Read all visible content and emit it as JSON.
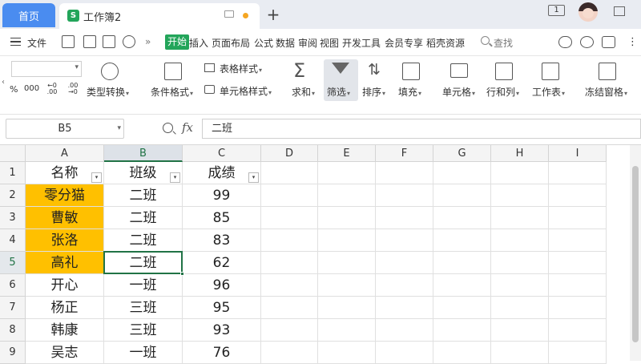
{
  "tabs": {
    "home": "首页",
    "doc_icon": "S",
    "doc_title": "工作簿2",
    "new_tab": "+"
  },
  "window": {
    "badge": "1"
  },
  "menu": {
    "file": "文件",
    "more": "»",
    "start": "开始",
    "insert": "插入",
    "page_layout": "页面布局",
    "formula": "公式",
    "data": "数据",
    "review": "审阅",
    "view": "视图",
    "developer": "开发工具",
    "member": "会员专享",
    "resources": "稻壳资源",
    "search": "查找"
  },
  "ribbon": {
    "percent": "%",
    "thousands": "000",
    "dec_inc": "←0 .00",
    "dec_dec": ".00 →0",
    "type_convert": "类型转换",
    "cond_format": "条件格式",
    "table_style": "表格样式",
    "cell_style": "单元格样式",
    "sum": "求和",
    "filter": "筛选",
    "sort": "排序",
    "fill": "填充",
    "cell": "单元格",
    "rowcol": "行和列",
    "sheet": "工作表",
    "freeze": "冻结窗格"
  },
  "formula_bar": {
    "name_box": "B5",
    "fx": "fx",
    "content": "二班"
  },
  "columns": [
    "A",
    "B",
    "C",
    "D",
    "E",
    "F",
    "G",
    "H",
    "I"
  ],
  "selected_column": "B",
  "selected_row": "5",
  "rows": [
    {
      "num": "1",
      "a": "名称",
      "b": "班级",
      "c": "成绩",
      "header": true
    },
    {
      "num": "2",
      "a": "零分猫",
      "b": "二班",
      "c": "99",
      "hl": true
    },
    {
      "num": "3",
      "a": "曹敏",
      "b": "二班",
      "c": "85",
      "hl": true
    },
    {
      "num": "4",
      "a": "张洛",
      "b": "二班",
      "c": "83",
      "hl": true
    },
    {
      "num": "5",
      "a": "高礼",
      "b": "二班",
      "c": "62",
      "hl": true
    },
    {
      "num": "6",
      "a": "开心",
      "b": "一班",
      "c": "96"
    },
    {
      "num": "7",
      "a": "杨正",
      "b": "三班",
      "c": "95"
    },
    {
      "num": "8",
      "a": "韩康",
      "b": "三班",
      "c": "93"
    },
    {
      "num": "9",
      "a": "吴志",
      "b": "一班",
      "c": "76"
    }
  ],
  "colors": {
    "highlight": "#ffc000",
    "accent_green": "#23a55a",
    "home_tab": "#4a8cf0",
    "selection": "#217346"
  }
}
